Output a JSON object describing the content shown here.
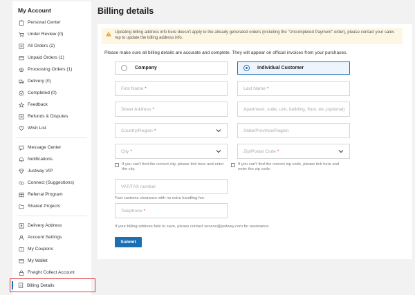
{
  "sidebar": {
    "title": "My Account",
    "group1": [
      {
        "label": "Personal Center",
        "icon": "clipboard-icon"
      },
      {
        "label": "Under Review (0)",
        "icon": "cart-icon"
      },
      {
        "label": "All Orders (2)",
        "icon": "list-icon"
      },
      {
        "label": "Unpaid Orders (1)",
        "icon": "wallet-icon"
      },
      {
        "label": "Processing Orders (1)",
        "icon": "gear-icon"
      },
      {
        "label": "Delivery (0)",
        "icon": "truck-icon"
      },
      {
        "label": "Completed (0)",
        "icon": "check-circle-icon"
      },
      {
        "label": "Feedback",
        "icon": "star-icon"
      },
      {
        "label": "Refunds & Disputes",
        "icon": "refund-icon"
      },
      {
        "label": "Wish List",
        "icon": "heart-icon"
      }
    ],
    "group2": [
      {
        "label": "Message Center",
        "icon": "message-icon"
      },
      {
        "label": "Notifications",
        "icon": "bell-icon"
      },
      {
        "label": "Justway VIP",
        "icon": "vip-icon"
      },
      {
        "label": "Connect (Suggestions)",
        "icon": "connect-icon"
      },
      {
        "label": "Referral Program",
        "icon": "referral-icon"
      },
      {
        "label": "Shared Projects",
        "icon": "folder-icon"
      }
    ],
    "group3": [
      {
        "label": "Delivery Address",
        "icon": "address-icon"
      },
      {
        "label": "Account Settings",
        "icon": "user-icon"
      },
      {
        "label": "My Coupons",
        "icon": "coupon-icon"
      },
      {
        "label": "My Wallet",
        "icon": "wallet-icon"
      },
      {
        "label": "Freight Collect Account",
        "icon": "lock-icon"
      },
      {
        "label": "Billing Details",
        "icon": "billing-icon"
      }
    ]
  },
  "main": {
    "title": "Billing details",
    "warning": "Updating billing address info here doesn't apply to the already generated orders (including the \"Uncompleted Payment\" order), please contact your sales rep to update the billing address info.",
    "note": "Please make sure all billing details are accurate and complete. They will appear on official invoices from your purchases.",
    "type_company": "Company",
    "type_individual": "Individual Customer",
    "first_name": "First Name",
    "last_name": "Last Name",
    "street": "Street Address",
    "apartment": "Apartment, suite, unit, building, floor, etc.(optional)",
    "country": "Country/Region",
    "state": "State/Province/Region",
    "city": "City",
    "zip": "Zip/Postal Code",
    "city_hint": "If you can't find the correct city, please tick here and enter the city.",
    "zip_hint": "If you can't find the correct zip code, please tick here and enter the zip code.",
    "vat": "VAT/TAX number",
    "vat_hint": "Fast customs clearance with no extra handling fee.",
    "telephone": "Telephone",
    "save_hint": "If your billing address fails to save, please contact service@justway.com for assistance.",
    "submit": "Submit",
    "required_mark": "*"
  },
  "colors": {
    "accent": "#1a6fb5",
    "required": "#d9363e",
    "warning_bg": "#fdf6e3",
    "warning_icon": "#f0a020"
  }
}
